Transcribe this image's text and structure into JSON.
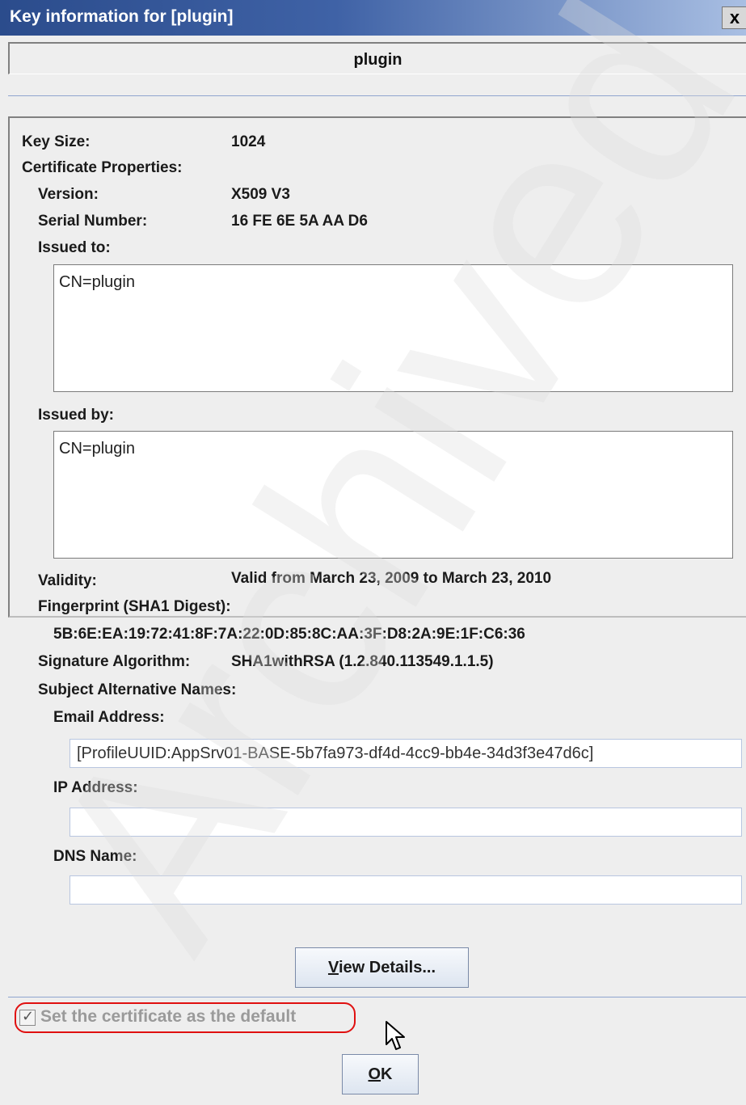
{
  "window": {
    "title": "Key information for [plugin]",
    "close_glyph": "x"
  },
  "header": {
    "key_label": "plugin"
  },
  "key": {
    "size_label": "Key Size:",
    "size_value": "1024",
    "cert_props_label": "Certificate Properties:",
    "version_label": "Version:",
    "version_value": "X509 V3",
    "serial_label": "Serial Number:",
    "serial_value": "16 FE 6E 5A AA D6",
    "issued_to_label": "Issued to:",
    "issued_to_value": "CN=plugin",
    "issued_by_label": "Issued by:",
    "issued_by_value": "CN=plugin",
    "validity_label": "Validity:",
    "validity_value": "Valid from March 23, 2009 to March 23, 2010",
    "fingerprint_label": "Fingerprint (SHA1 Digest):",
    "fingerprint_value": "5B:6E:EA:19:72:41:8F:7A:22:0D:85:8C:AA:3F:D8:2A:9E:1F:C6:36",
    "sig_alg_label": "Signature Algorithm:",
    "sig_alg_value": "SHA1withRSA (1.2.840.113549.1.1.5)",
    "san_label": "Subject Alternative Names:",
    "email_label": "Email Address:",
    "email_value": "[ProfileUUID:AppSrv01-BASE-5b7fa973-df4d-4cc9-bb4e-34d3f3e47d6c]",
    "ip_label": "IP Address:",
    "ip_value": "",
    "dns_label": "DNS Name:",
    "dns_value": ""
  },
  "buttons": {
    "view_details_mnemonic": "V",
    "view_details_rest": "iew Details...",
    "ok_mnemonic": "O",
    "ok_rest": "K"
  },
  "default_checkbox": {
    "label": "Set the certificate as the default",
    "checked": true,
    "check_glyph": "✓"
  },
  "watermark": {
    "text": "Archived"
  },
  "colors": {
    "title_bar": "#2b4c8c",
    "highlight_outline": "#e01010",
    "watermark": "#e6e6e6"
  }
}
